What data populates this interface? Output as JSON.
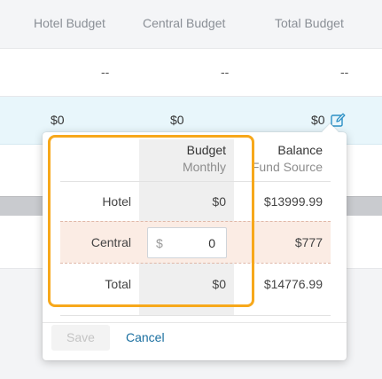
{
  "table": {
    "headers": [
      "Hotel Budget",
      "Central Budget",
      "Total Budget"
    ],
    "empty_row": [
      "--",
      "--",
      "--"
    ],
    "active_row": [
      "$0",
      "$0",
      "$0"
    ]
  },
  "popover": {
    "columns": {
      "budget_title": "Budget",
      "budget_sub": "Monthly",
      "balance_title": "Balance",
      "balance_sub": "Fund Source"
    },
    "rows": [
      {
        "label": "Hotel",
        "budget": "$0",
        "balance": "$13999.99"
      },
      {
        "label": "Central",
        "prefix": "$",
        "input_value": "0",
        "balance": "$777"
      },
      {
        "label": "Total",
        "budget": "$0",
        "balance": "$14776.99"
      }
    ],
    "save_label": "Save",
    "cancel_label": "Cancel"
  },
  "colors": {
    "accent": "#1a6fa0",
    "focus_outline": "#f7a81b",
    "active_row_bg": "#e8f6fb",
    "central_row_bg": "#fbece4"
  },
  "icons": {
    "edit": "edit-icon"
  }
}
